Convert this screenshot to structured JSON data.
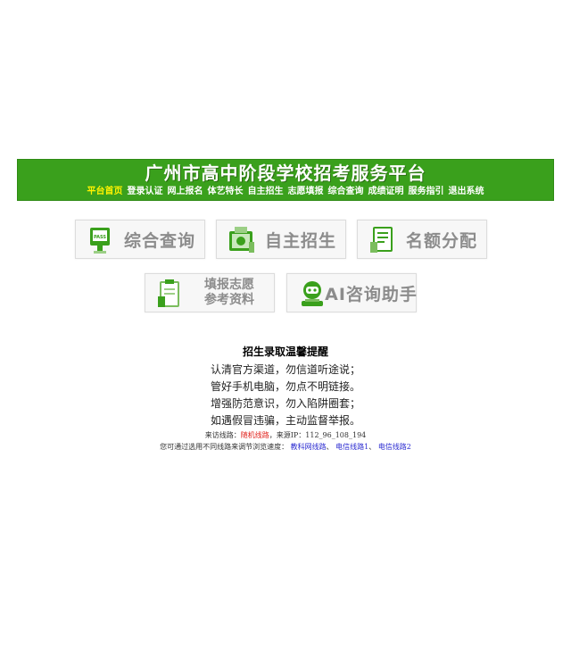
{
  "header": {
    "title": "广州市高中阶段学校招考服务平台",
    "nav": [
      {
        "label": "平台首页",
        "active": true
      },
      {
        "label": "登录认证",
        "active": false
      },
      {
        "label": "网上报名",
        "active": false
      },
      {
        "label": "体艺特长",
        "active": false
      },
      {
        "label": "自主招生",
        "active": false
      },
      {
        "label": "志愿填报",
        "active": false
      },
      {
        "label": "综合查询",
        "active": false
      },
      {
        "label": "成绩证明",
        "active": false
      },
      {
        "label": "服务指引",
        "active": false
      },
      {
        "label": "退出系统",
        "active": false
      }
    ]
  },
  "tiles": {
    "query": {
      "label": "综合查询",
      "icon": "monitor-icon"
    },
    "self_enroll": {
      "label": "自主招生",
      "icon": "book-icon"
    },
    "quota": {
      "label": "名额分配",
      "icon": "document-icon"
    },
    "volunteer_ref": {
      "line1": "填报志愿",
      "line2": "参考资料",
      "icon": "clipboard-icon"
    },
    "ai": {
      "label": "AI咨询助手",
      "icon": "robot-icon"
    }
  },
  "notice": {
    "title": "招生录取温馨提醒",
    "lines": [
      "认清官方渠道，勿信道听途说；",
      "管好手机电脑，勿点不明链接。",
      "增强防范意识，勿入陷阱圈套；",
      "如遇假冒违骗，主动监督举报。"
    ]
  },
  "line_info": {
    "visit_label": "来访线路：",
    "visit_value": "随机线路",
    "source_label": "，来源IP：",
    "source_ip": "112_96_108_194",
    "switch_text": "您可通过选用不同线路来调节浏览速度：",
    "links": [
      "教科网线路",
      "电信线路1",
      "电信线路2"
    ],
    "sep": "、"
  },
  "colors": {
    "banner": "#3aa01c",
    "nav_active": "#fff200",
    "tile_text": "#8c8c8c",
    "icon_green": "#3aa01c",
    "link_red": "#e0201a",
    "link_blue": "#2a2ad0"
  }
}
